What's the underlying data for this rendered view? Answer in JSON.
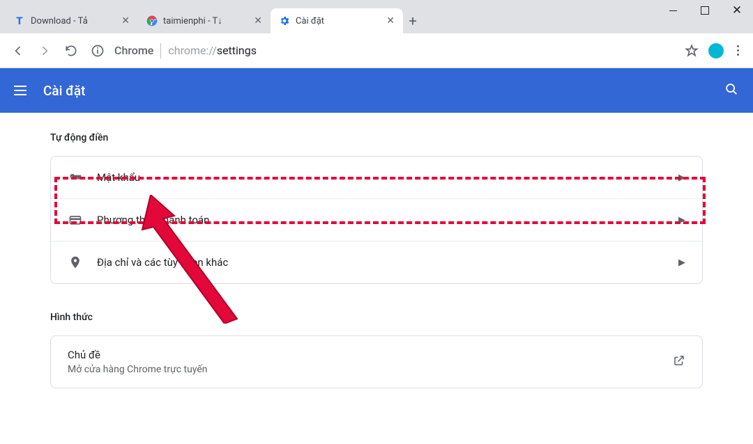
{
  "window_controls": {
    "minimize": "minimize",
    "maximize": "maximize",
    "close": "close"
  },
  "tabs": [
    {
      "favicon": "T",
      "title": "Download - Tả"
    },
    {
      "favicon": "G",
      "title": "taimienphi - T↓"
    },
    {
      "favicon": "gear",
      "title": "Cài đặt"
    }
  ],
  "toolbar": {
    "chrome_label": "Chrome",
    "url_scheme": "chrome://",
    "url_path": "settings"
  },
  "header": {
    "title": "Cài đặt"
  },
  "sections": {
    "autofill": {
      "title": "Tự động điền",
      "rows": {
        "passwords": "Mật khẩu",
        "payment": "Phương thức thanh toán",
        "addresses": "Địa chỉ và các tùy chọn khác"
      }
    },
    "appearance": {
      "title": "Hình thức",
      "theme": {
        "label": "Chủ đề",
        "sub": "Mở cửa hàng Chrome trực tuyến"
      }
    }
  },
  "colors": {
    "accent": "#3367d6",
    "highlight": "#e3073a"
  }
}
